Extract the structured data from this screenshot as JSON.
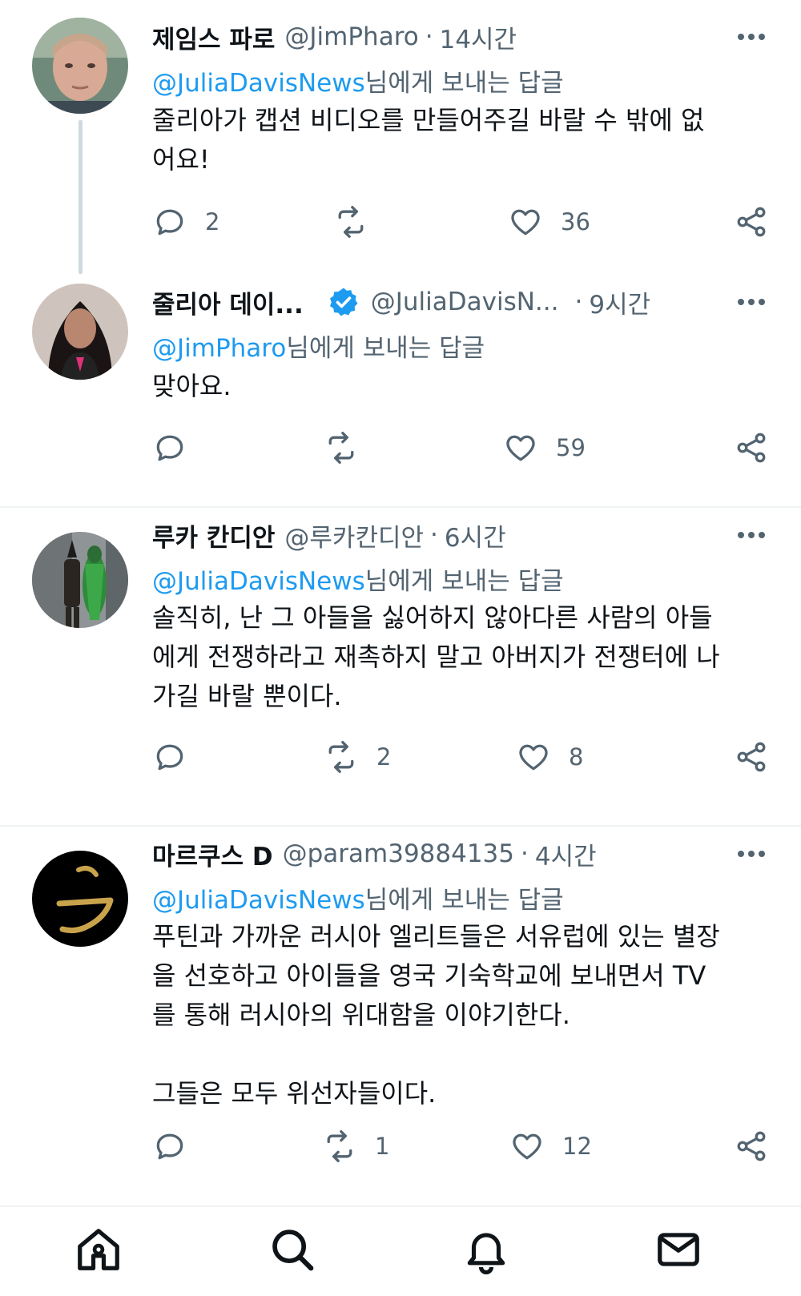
{
  "tweets": [
    {
      "name": "제임스 파로",
      "handle": "@JimPharo",
      "separator": "·",
      "time": "14시간",
      "reply_prefix": "@JuliaDavisNews",
      "reply_suffix": "님에게 보내는 답글",
      "body": "줄리아가 캡션 비디오를 만들어주길 바랄 수 밖에 없\n어요!",
      "replies": "2",
      "retweets": "",
      "likes": "36",
      "verified": false
    },
    {
      "name": "줄리아 데이...",
      "handle": "@JuliaDavisN...",
      "separator": "·",
      "time": "9시간",
      "reply_prefix": "@JimPharo",
      "reply_suffix": "님에게 보내는 답글",
      "body": "맞아요.",
      "replies": "",
      "retweets": "",
      "likes": "59",
      "verified": true
    },
    {
      "name": "루카 칸디안",
      "handle": "@루카칸디안",
      "separator": "·",
      "time": "6시간",
      "reply_prefix": "@JuliaDavisNews",
      "reply_suffix": "님에게 보내는 답글",
      "body": "솔직히, 난 그 아들을 싫어하지 않아다른 사람의 아들\n에게 전쟁하라고 재촉하지 말고 아버지가 전쟁터에 나\n가길 바랄 뿐이다.",
      "replies": "",
      "retweets": "2",
      "likes": "8",
      "verified": false
    },
    {
      "name": "마르쿠스 D",
      "handle": "@param39884135",
      "separator": "·",
      "time": "4시간",
      "reply_prefix": "@JuliaDavisNews",
      "reply_suffix": "님에게 보내는 답글",
      "body": "푸틴과 가까운 러시아 엘리트들은 서유럽에 있는 별장\n을 선호하고 아이들을 영국 기숙학교에 보내면서 TV\n를 통해 러시아의 위대함을 이야기한다.\n\n그들은 모두 위선자들이다.",
      "replies": "",
      "retweets": "1",
      "likes": "12",
      "verified": false
    }
  ],
  "icons": {
    "more": "more-dots-icon",
    "reply": "reply-bubble-icon",
    "retweet": "retweet-icon",
    "like": "heart-icon",
    "share": "share-icon",
    "verified": "verified-badge-icon"
  },
  "nav": [
    "home-icon",
    "search-icon",
    "notifications-icon",
    "messages-icon"
  ],
  "colors": {
    "link": "#1d9bf0",
    "secondary_text": "#536471",
    "primary_text": "#0f1419",
    "divider": "#eff3f4",
    "verified": "#1d9bf0"
  }
}
